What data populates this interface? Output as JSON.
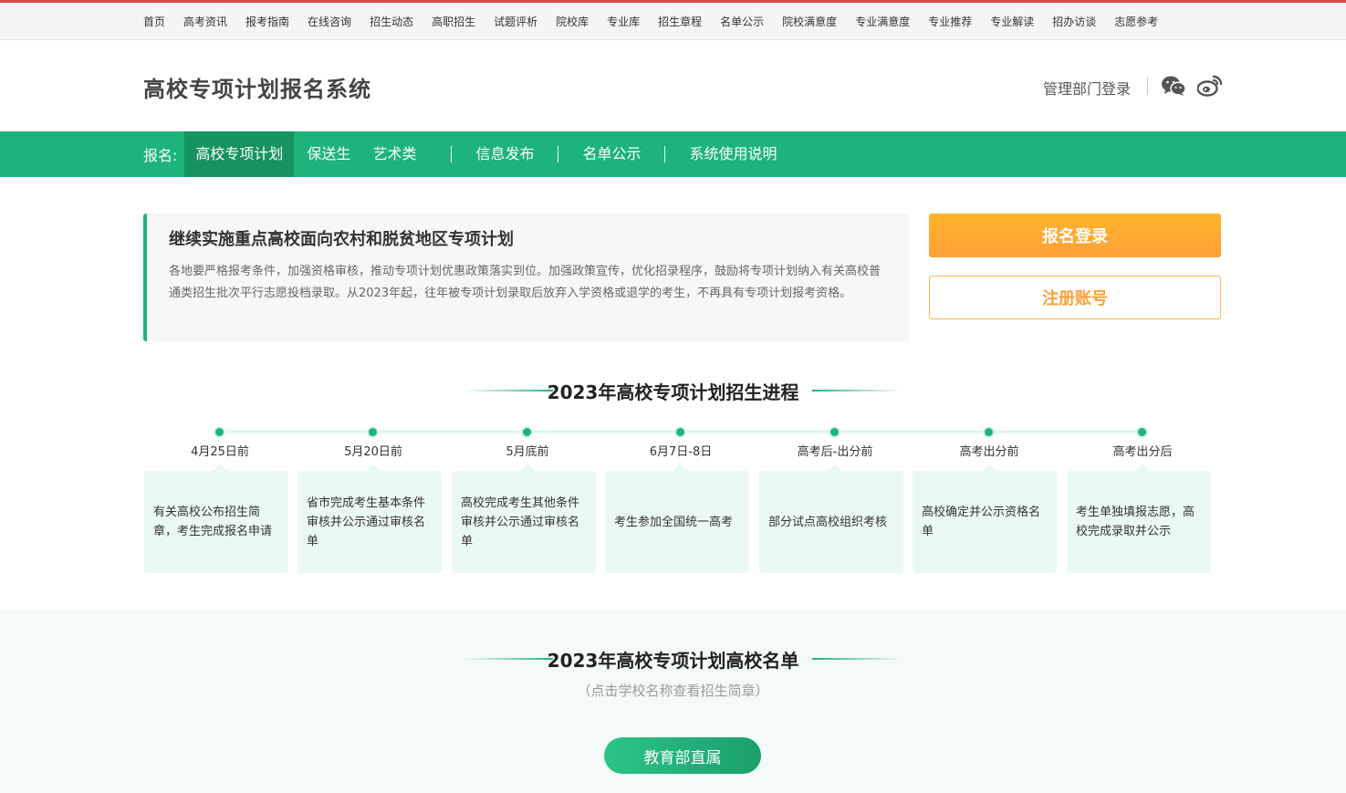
{
  "top_nav": [
    "首页",
    "高考资讯",
    "报考指南",
    "在线咨询",
    "招生动态",
    "高职招生",
    "试题评析",
    "院校库",
    "专业库",
    "招生章程",
    "名单公示",
    "院校满意度",
    "专业满意度",
    "专业推荐",
    "专业解读",
    "招办访谈",
    "志愿参考"
  ],
  "header": {
    "title": "高校专项计划报名系统",
    "admin_login": "管理部门登录"
  },
  "main_nav": {
    "label": "报名:",
    "items": [
      "高校专项计划",
      "保送生",
      "艺术类",
      "信息发布",
      "名单公示",
      "系统使用说明"
    ]
  },
  "notice": {
    "title": "继续实施重点高校面向农村和脱贫地区专项计划",
    "body": "各地要严格报考条件，加强资格审核，推动专项计划优惠政策落实到位。加强政策宣传，优化招录程序，鼓励将专项计划纳入有关高校普通类招生批次平行志愿投档录取。从2023年起，往年被专项计划录取后放弃入学资格或退学的考生，不再具有专项计划报考资格。"
  },
  "buttons": {
    "login": "报名登录",
    "register": "注册账号"
  },
  "timeline": {
    "title": "2023年高校专项计划招生进程",
    "steps": [
      {
        "date": "4月25日前",
        "text": "有关高校公布招生简章，考生完成报名申请"
      },
      {
        "date": "5月20日前",
        "text": "省市完成考生基本条件审核并公示通过审核名单"
      },
      {
        "date": "5月底前",
        "text": "高校完成考生其他条件审核并公示通过审核名单"
      },
      {
        "date": "6月7日-8日",
        "text": "考生参加全国统一高考"
      },
      {
        "date": "高考后-出分前",
        "text": "部分试点高校组织考核"
      },
      {
        "date": "高考出分前",
        "text": "高校确定并公示资格名单"
      },
      {
        "date": "高考出分后",
        "text": "考生单独填报志愿，高校完成录取并公示"
      }
    ]
  },
  "school_list": {
    "title": "2023年高校专项计划高校名单",
    "subtitle": "（点击学校名称查看招生简章）",
    "category_button": "教育部直属"
  },
  "colors": {
    "brand_green": "#1eb37a",
    "active_green": "#17935f",
    "accent_orange": "#ff9f3a",
    "top_border_red": "#e04a4a"
  },
  "icons": [
    "wechat-icon",
    "weibo-icon"
  ]
}
